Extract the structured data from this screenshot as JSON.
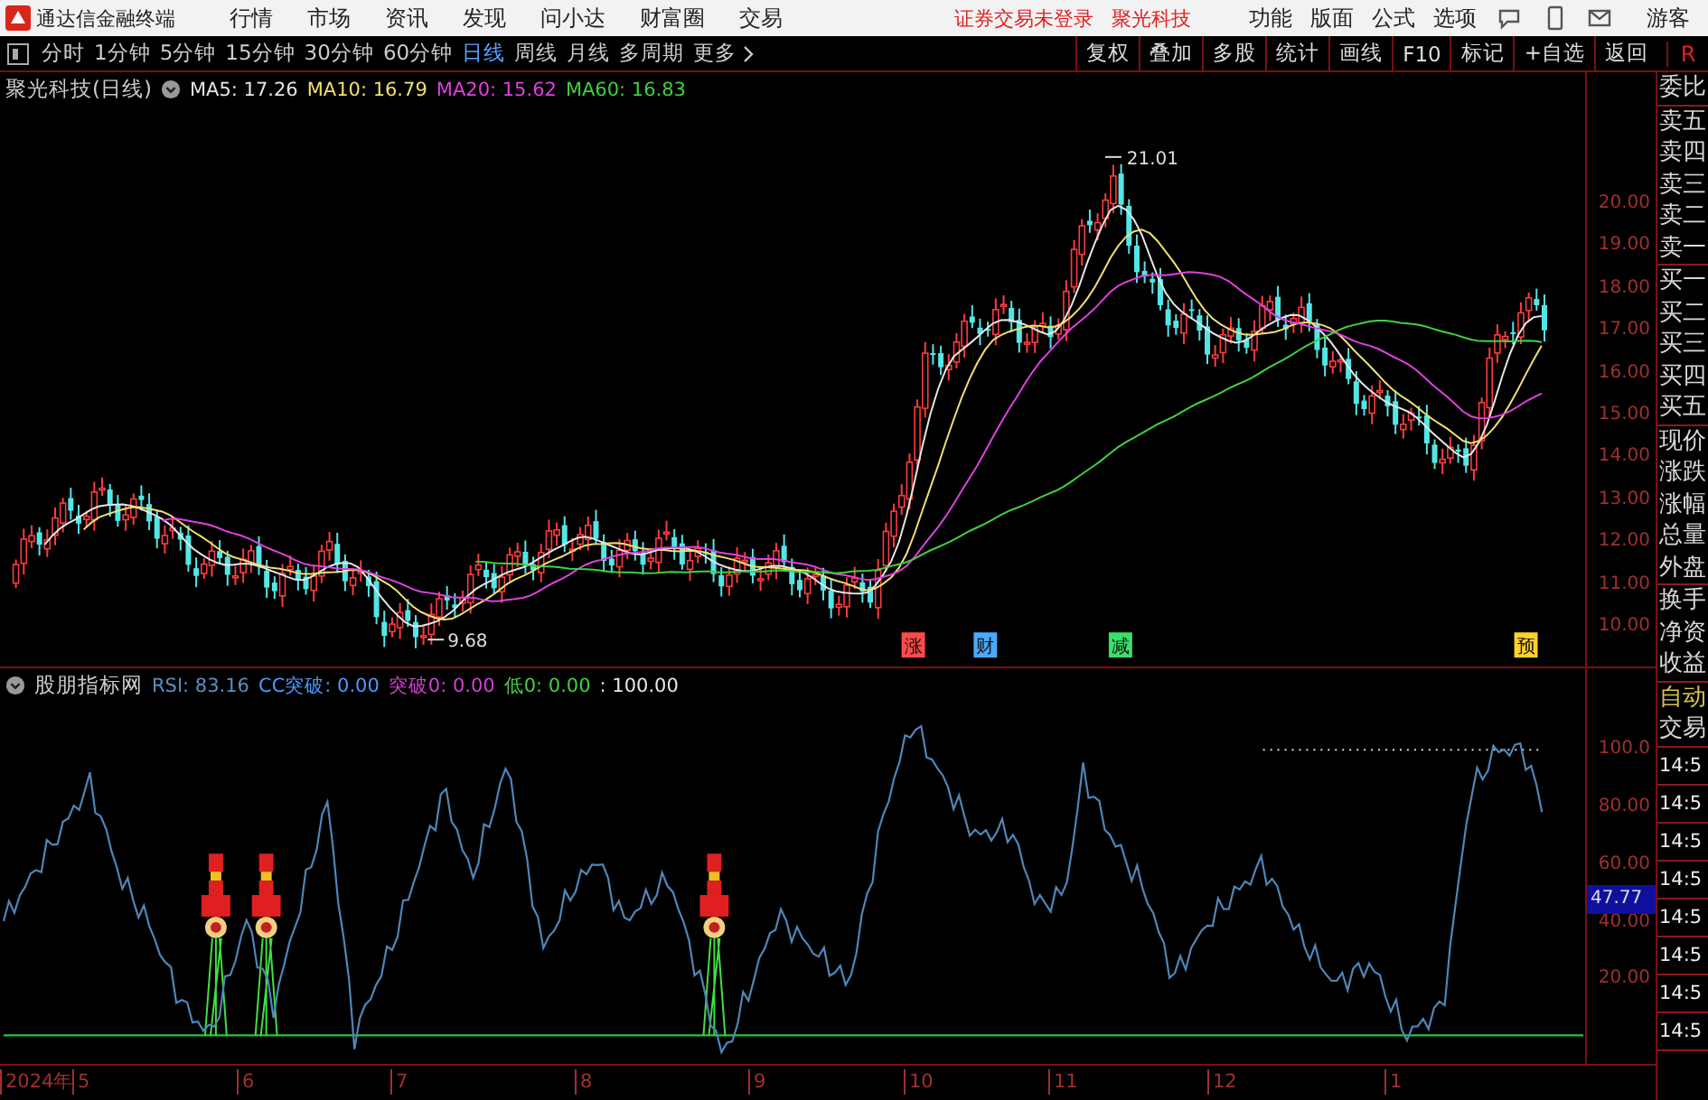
{
  "menu_bar": {
    "app_title": "通达信金融终端",
    "menus": [
      "行情",
      "市场",
      "资讯",
      "发现",
      "问小达",
      "财富圈",
      "交易"
    ],
    "notice": "证券交易未登录",
    "stock": "聚光科技",
    "options": [
      "功能",
      "版面",
      "公式",
      "选项"
    ],
    "user": "游客"
  },
  "toolbar": {
    "periods": [
      {
        "label": "分时",
        "selected": false
      },
      {
        "label": "1分钟",
        "selected": false
      },
      {
        "label": "5分钟",
        "selected": false
      },
      {
        "label": "15分钟",
        "selected": false
      },
      {
        "label": "30分钟",
        "selected": false
      },
      {
        "label": "60分钟",
        "selected": false
      },
      {
        "label": "日线",
        "selected": true
      },
      {
        "label": "周线",
        "selected": false
      },
      {
        "label": "月线",
        "selected": false
      },
      {
        "label": "多周期",
        "selected": false
      }
    ],
    "more": "更多",
    "actions": [
      "复权",
      "叠加",
      "多股",
      "统计",
      "画线",
      "F10",
      "标记",
      "+自选",
      "返回"
    ],
    "corner": "R"
  },
  "price_chart": {
    "title": "聚光科技(日线)",
    "ma": [
      {
        "label": "MA5: 17.26",
        "color": "#e6e6e6"
      },
      {
        "label": "MA10: 16.79",
        "color": "#f0e070"
      },
      {
        "label": "MA20: 15.62",
        "color": "#e040e0"
      },
      {
        "label": "MA60: 16.83",
        "color": "#40d040"
      }
    ],
    "high_label": "21.01",
    "low_label": "9.68",
    "events": [
      {
        "label": "涨",
        "color": "#ff4a4a"
      },
      {
        "label": "财",
        "color": "#4aa8ff"
      },
      {
        "label": "减",
        "color": "#3adf6a"
      },
      {
        "label": "预",
        "color": "#ffd030"
      }
    ],
    "yticks": [
      "20.00",
      "19.00",
      "18.00",
      "17.00",
      "16.00",
      "15.00",
      "14.00",
      "13.00",
      "12.00",
      "11.00",
      "10.00"
    ]
  },
  "indicator": {
    "title": "股朋指标网",
    "values": [
      {
        "label": "RSI: 83.16",
        "color": "#5a8fc0"
      },
      {
        "label": "CC突破: 0.00",
        "color": "#4a9aff"
      },
      {
        "label": "突破0: 0.00",
        "color": "#d040d0"
      },
      {
        "label": "低0: 0.00",
        "color": "#40d040"
      },
      {
        "label": ": 100.00",
        "color": "#e6e6e6"
      }
    ],
    "yticks": [
      "100.0",
      "80.00",
      "60.00",
      "40.00",
      "20.00"
    ],
    "current": "47.77"
  },
  "x_axis": [
    "2024年",
    "5",
    "6",
    "7",
    "8",
    "9",
    "10",
    "11",
    "12",
    "1"
  ],
  "quote_panel": {
    "groups": [
      [
        "委比"
      ],
      [
        "卖五",
        "卖四",
        "卖三",
        "卖二",
        "卖一"
      ],
      [
        "买一",
        "买二",
        "买三",
        "买四",
        "买五"
      ],
      [
        "现价",
        "涨跌",
        "涨幅",
        "总量",
        "外盘"
      ],
      [
        "换手",
        "净资",
        "收益"
      ]
    ]
  },
  "trade_panel": {
    "title": "自动",
    "subtitle": "交易",
    "times": [
      "14:5",
      "14:5",
      "14:5",
      "14:5",
      "14:5",
      "14:5",
      "14:5",
      "14:5"
    ]
  }
}
